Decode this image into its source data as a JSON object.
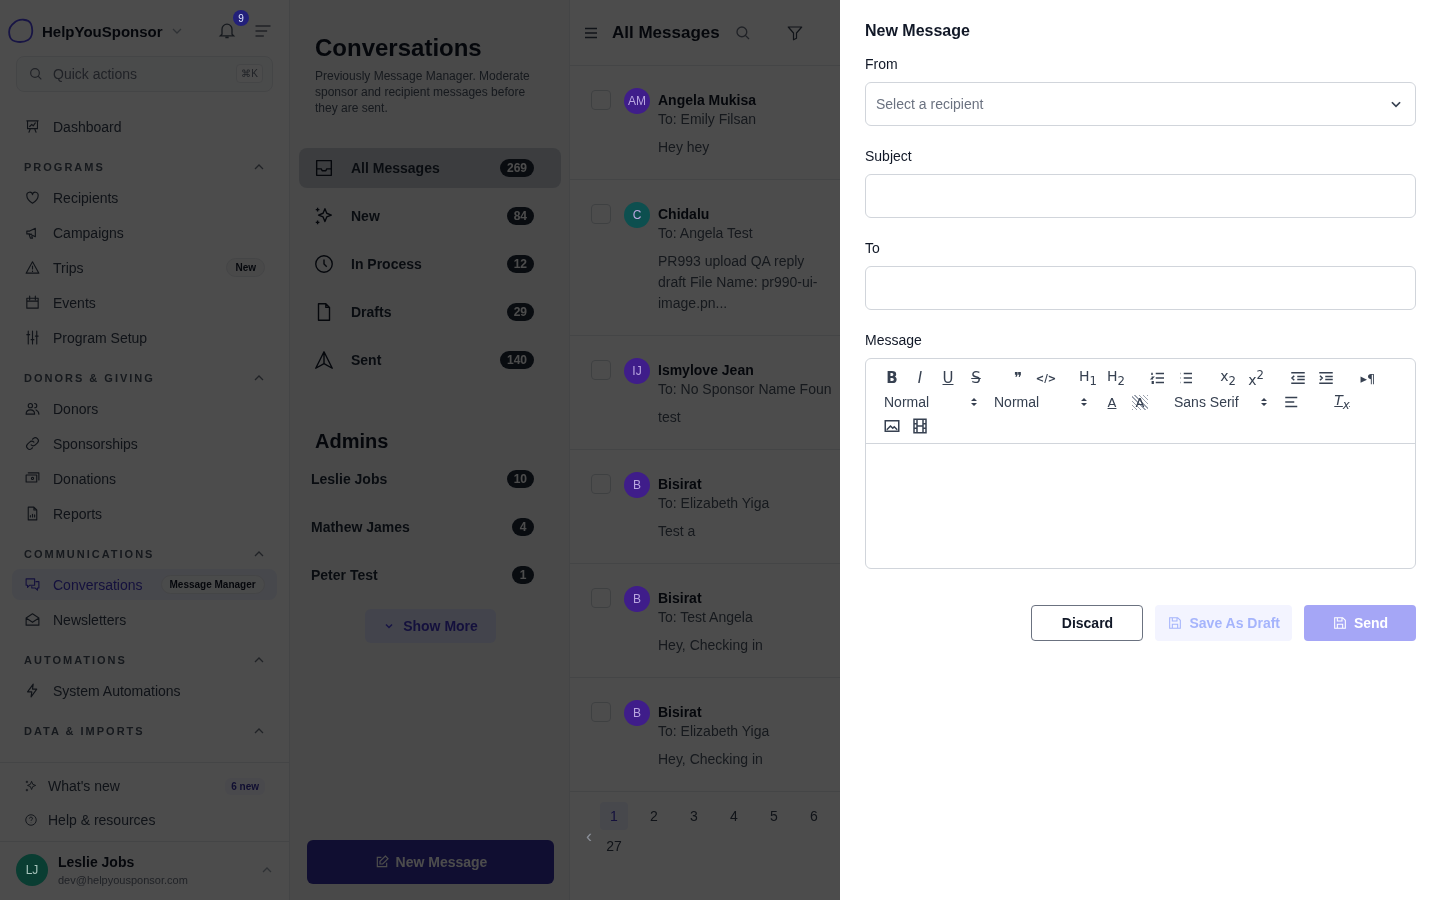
{
  "sidebar": {
    "brand": "HelpYouSponsor",
    "notification_count": "9",
    "search": {
      "placeholder": "Quick actions",
      "shortcut": "⌘K"
    },
    "top_items": [
      {
        "label": "Dashboard",
        "selected": false
      }
    ],
    "groups": [
      {
        "title": "PROGRAMS",
        "expanded": true,
        "items": [
          {
            "label": "Recipients",
            "selected": false
          },
          {
            "label": "Campaigns",
            "selected": false
          },
          {
            "label": "Trips",
            "selected": false,
            "badge": "New"
          },
          {
            "label": "Events",
            "selected": false
          },
          {
            "label": "Program Setup",
            "selected": false
          }
        ]
      },
      {
        "title": "DONORS & GIVING",
        "expanded": true,
        "items": [
          {
            "label": "Donors",
            "selected": false
          },
          {
            "label": "Sponsorships",
            "selected": false
          },
          {
            "label": "Donations",
            "selected": false
          },
          {
            "label": "Reports",
            "selected": false
          }
        ]
      },
      {
        "title": "COMMUNICATIONS",
        "expanded": true,
        "items": [
          {
            "label": "Conversations",
            "selected": true,
            "badge": "Message Manager"
          },
          {
            "label": "Newsletters",
            "selected": false
          }
        ]
      },
      {
        "title": "AUTOMATIONS",
        "expanded": true,
        "items": [
          {
            "label": "System Automations",
            "selected": false
          }
        ]
      },
      {
        "title": "DATA & IMPORTS",
        "expanded": true
      }
    ],
    "footer_links": [
      {
        "label": "What's new",
        "badge": "6 new"
      },
      {
        "label": "Help & resources"
      }
    ],
    "user": {
      "initials": "LJ",
      "name": "Leslie Jobs",
      "email": "dev@helpyousponsor.com"
    }
  },
  "conversations": {
    "title": "Conversations",
    "description": "Previously Message Manager. Moderate sponsor and recipient messages before they are sent.",
    "folders": [
      {
        "label": "All Messages",
        "count": "269",
        "selected": true
      },
      {
        "label": "New",
        "count": "84",
        "selected": false
      },
      {
        "label": "In Process",
        "count": "12",
        "selected": false
      },
      {
        "label": "Drafts",
        "count": "29",
        "selected": false
      },
      {
        "label": "Sent",
        "count": "140",
        "selected": false
      }
    ],
    "admins_title": "Admins",
    "admins": [
      {
        "name": "Leslie Jobs",
        "count": "10"
      },
      {
        "name": "Mathew James",
        "count": "4"
      },
      {
        "name": "Peter Test",
        "count": "1"
      }
    ],
    "show_more": "Show More",
    "new_message_button": "New Message"
  },
  "messages": {
    "title": "All Messages",
    "rows": [
      {
        "checked": false,
        "initials": "AM",
        "color": "#3f1d8a",
        "sender": "Angela Mukisa",
        "to": "To: Emily Filsan",
        "preview": "Hey hey"
      },
      {
        "checked": false,
        "initials": "C",
        "color": "#0d4f4f",
        "sender": "Chidalu",
        "to": "To: Angela Test",
        "preview": "PR993 upload QA reply draft File Name: pr990-ui-image.pn..."
      },
      {
        "checked": false,
        "initials": "IJ",
        "color": "#3f1d8a",
        "sender": "Ismylove Jean",
        "to": "To: No Sponsor Name Foun",
        "preview": "test"
      },
      {
        "checked": false,
        "initials": "B",
        "color": "#3f1d8a",
        "sender": "Bisirat",
        "to": "To: Elizabeth Yiga",
        "preview": "Test a"
      },
      {
        "checked": false,
        "initials": "B",
        "color": "#3f1d8a",
        "sender": "Bisirat",
        "to": "To: Test Angela",
        "preview": "Hey, Checking in"
      },
      {
        "checked": false,
        "initials": "B",
        "color": "#3f1d8a",
        "sender": "Bisirat",
        "to": "To: Elizabeth Yiga",
        "preview": "Hey, Checking in"
      }
    ],
    "pagination": {
      "prev": "‹",
      "prev_disabled": true,
      "pages": [
        {
          "label": "1",
          "selected": true
        },
        {
          "label": "2",
          "selected": false
        },
        {
          "label": "3",
          "selected": false
        },
        {
          "label": "4",
          "selected": false
        },
        {
          "label": "5",
          "selected": false
        },
        {
          "label": "6",
          "selected": false
        },
        {
          "label": "27",
          "selected": false
        }
      ]
    }
  },
  "drawer": {
    "title": "New Message",
    "from": {
      "label": "From",
      "placeholder": "Select a recipient"
    },
    "subject": {
      "label": "Subject"
    },
    "to": {
      "label": "To"
    },
    "message": {
      "label": "Message",
      "toolbar": [
        [
          {
            "kind": "glyph",
            "label": "B"
          },
          {
            "kind": "glyph",
            "label": "I"
          },
          {
            "kind": "glyph",
            "label": "U"
          },
          {
            "kind": "glyph",
            "label": "S"
          },
          {
            "kind": "gap"
          },
          {
            "kind": "glyph",
            "label": "❞"
          },
          {
            "kind": "glyph",
            "label": "</>"
          },
          {
            "kind": "gap"
          },
          {
            "kind": "glyph",
            "label": "H$_{1}$"
          },
          {
            "kind": "glyph",
            "label": "H$_{2}$"
          },
          {
            "kind": "gap"
          },
          {
            "kind": "icon"
          },
          {
            "kind": "icon"
          },
          {
            "kind": "gap"
          },
          {
            "kind": "glyph",
            "label": "x$_{2}$"
          },
          {
            "kind": "glyph",
            "label": "x$^{2}$"
          },
          {
            "kind": "gap"
          },
          {
            "kind": "icon"
          },
          {
            "kind": "icon"
          },
          {
            "kind": "gap"
          },
          {
            "kind": "glyph",
            "label": "▸¶"
          }
        ],
        [
          {
            "kind": "select",
            "label": "Normal"
          },
          {
            "kind": "select",
            "label": "Normal"
          },
          {
            "kind": "glyph",
            "label": "A"
          },
          {
            "kind": "glyph",
            "label": "A"
          },
          {
            "kind": "gap"
          },
          {
            "kind": "select",
            "label": "Sans Serif"
          },
          {
            "kind": "icon"
          },
          {
            "kind": "glyph",
            "label": "T$_{x}$"
          }
        ],
        [
          {
            "kind": "icon"
          },
          {
            "kind": "icon"
          }
        ]
      ]
    },
    "buttons": [
      {
        "label": "Discard",
        "kind": "secondary",
        "disabled": false
      },
      {
        "label": "Save As Draft",
        "kind": "draft",
        "disabled": true
      },
      {
        "label": "Send",
        "kind": "primary",
        "disabled": true
      }
    ]
  }
}
